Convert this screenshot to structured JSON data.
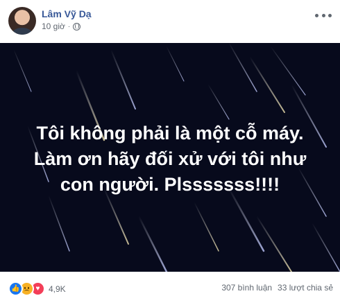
{
  "post": {
    "author": "Lâm Vỹ Dạ",
    "time": "10 giờ",
    "privacy_icon": "globe-icon",
    "image_text": [
      "Tôi không phải là một cỗ máy.",
      "Làm ơn hãy đối xử với tôi như",
      "con người. Plsssssss!!!!"
    ],
    "reactions": {
      "icons": [
        "like-icon",
        "sad-icon",
        "love-icon"
      ],
      "count": "4,9K"
    },
    "comments": "307 bình luận",
    "shares": "33 lượt chia sẻ"
  },
  "colors": {
    "author": "#385898",
    "image_bg": "#070a1c",
    "like": "#1877f2",
    "sad": "#f7b125",
    "love": "#f33e58"
  }
}
